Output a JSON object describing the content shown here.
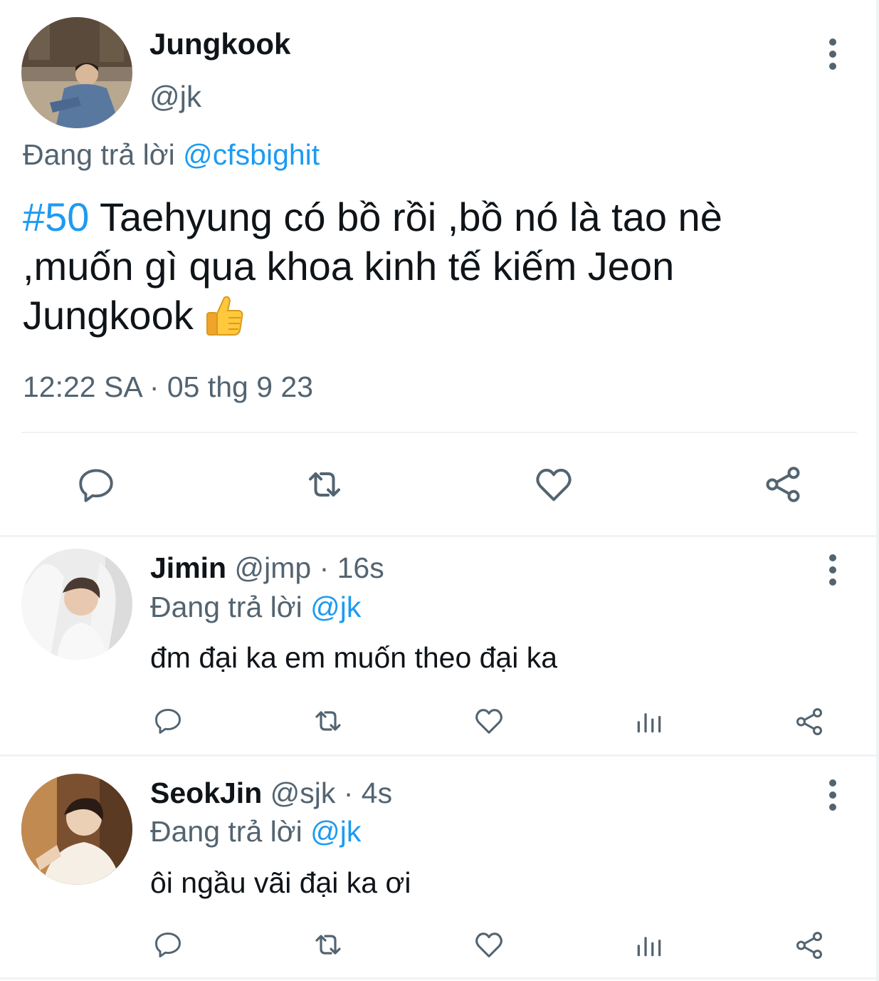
{
  "main_tweet": {
    "author_name": "Jungkook",
    "author_handle": "@jk",
    "replying_prefix": "Đang trả lời ",
    "replying_to": "@cfsbighit",
    "hashtag": "#50",
    "text": " Taehyung có bồ rồi ,bồ nó là tao nè ,muốn gì qua khoa kinh tế kiếm Jeon Jungkook ",
    "emoji": "thumbs-up",
    "timestamp": "12:22 SA · 05 thg 9 23",
    "actions": [
      "reply-icon",
      "retweet-icon",
      "like-icon",
      "share-icon"
    ]
  },
  "replies": [
    {
      "name": "Jimin",
      "handle": "@jmp",
      "time": " · 16s",
      "replying_prefix": "Đang trả lời ",
      "replying_to": "@jk",
      "text": "đm đại ka em muốn theo đại ka"
    },
    {
      "name": "SeokJin",
      "handle": "@sjk",
      "time": " · 4s",
      "replying_prefix": "Đang trả lời ",
      "replying_to": "@jk",
      "text": "ôi ngầu vãi đại ka ơi"
    }
  ],
  "colors": {
    "text": "#0f1419",
    "secondary": "#536471",
    "link": "#1d9bf0",
    "divider": "#eff3f4"
  }
}
